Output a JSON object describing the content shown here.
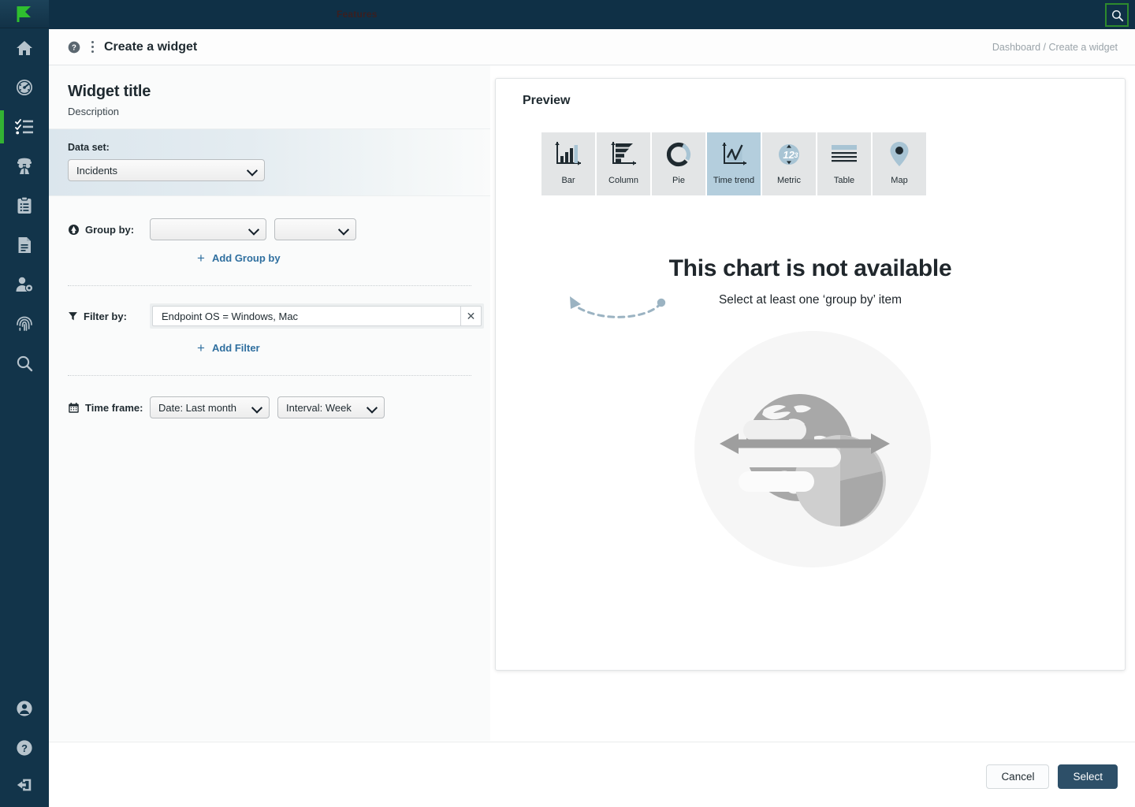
{
  "app": {
    "topbar_faint_text": "Features",
    "search_icon": "search-icon"
  },
  "rail": {
    "logo": "flag-logo",
    "items": [
      {
        "icon": "home-icon",
        "name": "home"
      },
      {
        "icon": "gauge-icon",
        "name": "dashboard"
      },
      {
        "icon": "checklist-icon",
        "name": "incidents",
        "active": true
      },
      {
        "icon": "spy-icon",
        "name": "threat-hunting"
      },
      {
        "icon": "clipboard-icon",
        "name": "playbooks"
      },
      {
        "icon": "document-icon",
        "name": "reports"
      },
      {
        "icon": "user-gear-icon",
        "name": "settings-users"
      },
      {
        "icon": "fingerprint-icon",
        "name": "forensics"
      },
      {
        "icon": "search-icon",
        "name": "search"
      }
    ],
    "bottom_items": [
      {
        "icon": "account-icon",
        "name": "account"
      },
      {
        "icon": "help-icon",
        "name": "help"
      },
      {
        "icon": "logout-icon",
        "name": "logout"
      }
    ]
  },
  "header": {
    "help_icon": "question-circle-icon",
    "kebab_icon": "kebab-menu-icon",
    "title": "Create a widget",
    "breadcrumb": "Dashboard / Create a widget"
  },
  "form": {
    "widget_title": "Widget title",
    "widget_description": "Description",
    "dataset": {
      "label": "Data set:",
      "value": "Incidents"
    },
    "group_by": {
      "icon": "group-by-icon",
      "label": "Group by:",
      "select_1": "",
      "select_2": "",
      "add_label": "Add Group by",
      "add_icon": "plus-icon"
    },
    "filter_by": {
      "icon": "filter-funnel-icon",
      "label": "Filter by:",
      "value": "Endpoint OS = Windows, Mac",
      "clear_icon": "close-icon",
      "add_label": "Add Filter",
      "add_icon": "plus-icon"
    },
    "time_frame": {
      "icon": "calendar-icon",
      "label": "Time frame:",
      "date": "Date: Last month",
      "interval": "Interval: Week"
    }
  },
  "preview": {
    "title": "Preview",
    "chart_types": [
      {
        "label": "Bar",
        "icon": "bar-chart-icon",
        "selected": false
      },
      {
        "label": "Column",
        "icon": "column-chart-icon",
        "selected": false
      },
      {
        "label": "Pie",
        "icon": "pie-chart-icon",
        "selected": false
      },
      {
        "label": "Time trend",
        "icon": "line-chart-icon",
        "selected": true
      },
      {
        "label": "Metric",
        "icon": "metric-123-icon",
        "selected": false
      },
      {
        "label": "Table",
        "icon": "table-icon",
        "selected": false
      },
      {
        "label": "Map",
        "icon": "map-pin-icon",
        "selected": false
      }
    ],
    "empty_title": "This chart is not available",
    "empty_subtitle": "Select at least one ‘group by’ item",
    "illustration_icon": "globe-chart-illustration",
    "arrow_icon": "curved-arrow-icon"
  },
  "footer": {
    "cancel_label": "Cancel",
    "select_label": "Select"
  },
  "colors": {
    "rail_bg": "#12344a",
    "topbar_bg": "#0f3046",
    "accent_green": "#33b233",
    "link_blue": "#2f6f9f",
    "selected_tile": "#b4cedd",
    "primary_button": "#2d4f68"
  }
}
